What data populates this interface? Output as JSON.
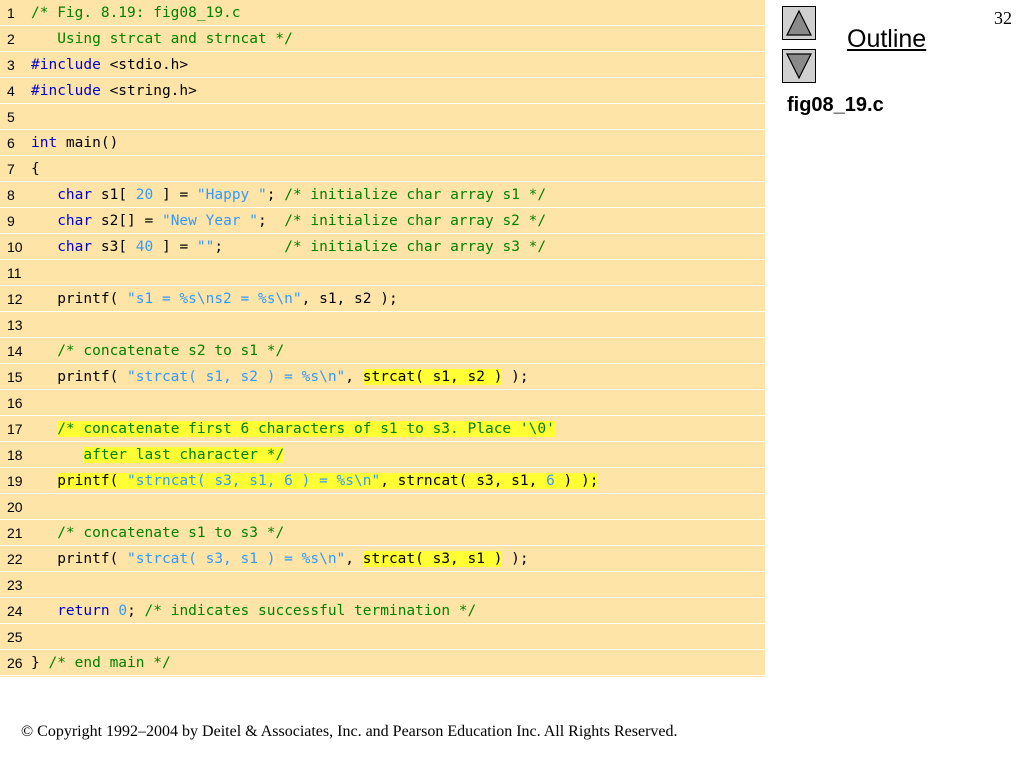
{
  "slide": {
    "number": "32",
    "outline_label": "Outline",
    "file_name": "fig08_19.c",
    "copyright": "© Copyright 1992–2004 by Deitel & Associates, Inc. and Pearson Education Inc. All Rights Reserved."
  },
  "nav": {
    "up_icon": "triangle-up-icon",
    "down_icon": "triangle-down-icon",
    "button_fill": "#d0d0d0"
  },
  "colors": {
    "panel": "#ffe4a7",
    "keyword": "#0000cc",
    "comment": "#008000",
    "string": "#3399ff",
    "highlight": "#ffff33"
  },
  "code": {
    "lines": [
      {
        "n": "1",
        "tokens": [
          {
            "t": "/* Fig. 8.19: fig08_19.c",
            "c": "cm"
          }
        ]
      },
      {
        "n": "2",
        "tokens": [
          {
            "t": "   Using strcat and strncat */",
            "c": "cm"
          }
        ]
      },
      {
        "n": "3",
        "tokens": [
          {
            "t": "#include",
            "c": "kw"
          },
          {
            "t": " <stdio.h>",
            "c": ""
          }
        ]
      },
      {
        "n": "4",
        "tokens": [
          {
            "t": "#include",
            "c": "kw"
          },
          {
            "t": " <string.h>",
            "c": ""
          }
        ]
      },
      {
        "n": "5",
        "tokens": []
      },
      {
        "n": "6",
        "tokens": [
          {
            "t": "int",
            "c": "kw"
          },
          {
            "t": " main()",
            "c": ""
          }
        ]
      },
      {
        "n": "7",
        "tokens": [
          {
            "t": "{",
            "c": ""
          }
        ]
      },
      {
        "n": "8",
        "tokens": [
          {
            "t": "   ",
            "c": ""
          },
          {
            "t": "char",
            "c": "kw"
          },
          {
            "t": " s1[ ",
            "c": ""
          },
          {
            "t": "20",
            "c": "num"
          },
          {
            "t": " ] = ",
            "c": ""
          },
          {
            "t": "\"Happy \"",
            "c": "str"
          },
          {
            "t": "; ",
            "c": ""
          },
          {
            "t": "/* initialize char array s1 */",
            "c": "cm"
          }
        ]
      },
      {
        "n": "9",
        "tokens": [
          {
            "t": "   ",
            "c": ""
          },
          {
            "t": "char",
            "c": "kw"
          },
          {
            "t": " s2[] = ",
            "c": ""
          },
          {
            "t": "\"New Year \"",
            "c": "str"
          },
          {
            "t": ";  ",
            "c": ""
          },
          {
            "t": "/* initialize char array s2 */",
            "c": "cm"
          }
        ]
      },
      {
        "n": "10",
        "tokens": [
          {
            "t": "   ",
            "c": ""
          },
          {
            "t": "char",
            "c": "kw"
          },
          {
            "t": " s3[ ",
            "c": ""
          },
          {
            "t": "40",
            "c": "num"
          },
          {
            "t": " ] = ",
            "c": ""
          },
          {
            "t": "\"\"",
            "c": "str"
          },
          {
            "t": ";       ",
            "c": ""
          },
          {
            "t": "/* initialize char array s3 */",
            "c": "cm"
          }
        ]
      },
      {
        "n": "11",
        "tokens": []
      },
      {
        "n": "12",
        "tokens": [
          {
            "t": "   printf( ",
            "c": ""
          },
          {
            "t": "\"s1 = %s\\ns2 = %s\\n\"",
            "c": "str"
          },
          {
            "t": ", s1, s2 );",
            "c": ""
          }
        ]
      },
      {
        "n": "13",
        "tokens": []
      },
      {
        "n": "14",
        "tokens": [
          {
            "t": "   ",
            "c": ""
          },
          {
            "t": "/* concatenate s2 to s1 */",
            "c": "cm"
          }
        ]
      },
      {
        "n": "15",
        "tokens": [
          {
            "t": "   printf( ",
            "c": ""
          },
          {
            "t": "\"strcat( s1, s2 ) = %s\\n\"",
            "c": "str"
          },
          {
            "t": ", ",
            "c": ""
          },
          {
            "t": "strcat( s1, s2 )",
            "c": "",
            "hl": true
          },
          {
            "t": " );",
            "c": ""
          }
        ]
      },
      {
        "n": "16",
        "tokens": []
      },
      {
        "n": "17",
        "tokens": [
          {
            "t": "   ",
            "c": ""
          },
          {
            "t": "/* concatenate first 6 characters of s1 to s3. Place '\\0'",
            "c": "cm",
            "hl": true
          }
        ]
      },
      {
        "n": "18",
        "tokens": [
          {
            "t": "      ",
            "c": ""
          },
          {
            "t": "after last character */",
            "c": "cm",
            "hl": true
          }
        ]
      },
      {
        "n": "19",
        "tokens": [
          {
            "t": "   ",
            "c": ""
          },
          {
            "t": "printf( ",
            "c": "",
            "hl": true
          },
          {
            "t": "\"strncat( s3, s1, 6 ) = %s\\n\"",
            "c": "str",
            "hl": true
          },
          {
            "t": ", strncat( s3, s1, ",
            "c": "",
            "hl": true
          },
          {
            "t": "6",
            "c": "num",
            "hl": true
          },
          {
            "t": " ) );",
            "c": "",
            "hl": true
          }
        ]
      },
      {
        "n": "20",
        "tokens": []
      },
      {
        "n": "21",
        "tokens": [
          {
            "t": "   ",
            "c": ""
          },
          {
            "t": "/* concatenate s1 to s3 */",
            "c": "cm"
          }
        ]
      },
      {
        "n": "22",
        "tokens": [
          {
            "t": "   printf( ",
            "c": ""
          },
          {
            "t": "\"strcat( s3, s1 ) = %s\\n\"",
            "c": "str"
          },
          {
            "t": ", ",
            "c": ""
          },
          {
            "t": "strcat( s3, s1 )",
            "c": "",
            "hl": true
          },
          {
            "t": " );",
            "c": ""
          }
        ]
      },
      {
        "n": "23",
        "tokens": []
      },
      {
        "n": "24",
        "tokens": [
          {
            "t": "   ",
            "c": ""
          },
          {
            "t": "return",
            "c": "kw"
          },
          {
            "t": " ",
            "c": ""
          },
          {
            "t": "0",
            "c": "num"
          },
          {
            "t": "; ",
            "c": ""
          },
          {
            "t": "/* indicates successful termination */",
            "c": "cm"
          }
        ]
      },
      {
        "n": "25",
        "tokens": []
      },
      {
        "n": "26",
        "tokens": [
          {
            "t": "} ",
            "c": ""
          },
          {
            "t": "/* end main */",
            "c": "cm"
          }
        ]
      }
    ]
  }
}
